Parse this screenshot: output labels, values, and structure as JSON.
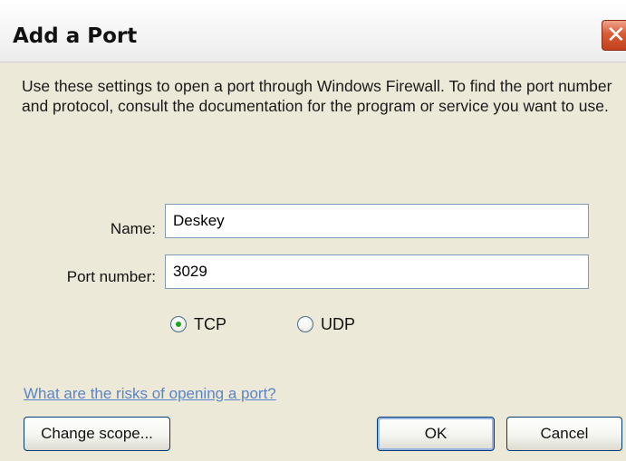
{
  "dialog": {
    "title": "Add a Port",
    "close_icon": "close-icon",
    "close_glyph": "✕",
    "instructions": "Use these settings to open a port through Windows Firewall. To find the port number and protocol, consult the documentation for the program or service you want to use.",
    "name_label": "Name:",
    "name_value": "Deskey",
    "port_label": "Port number:",
    "port_value": "3029",
    "protocol": {
      "selected": "TCP",
      "options": [
        "TCP",
        "UDP"
      ]
    },
    "help_link": "What are the risks of opening a port?",
    "buttons": {
      "change_scope": "Change scope...",
      "ok": "OK",
      "cancel": "Cancel"
    }
  },
  "colors": {
    "dialog_bg": "#ece9d8",
    "link": "#2a63c2",
    "close_red": "#d85b36",
    "radio_selected": "#21a121"
  }
}
